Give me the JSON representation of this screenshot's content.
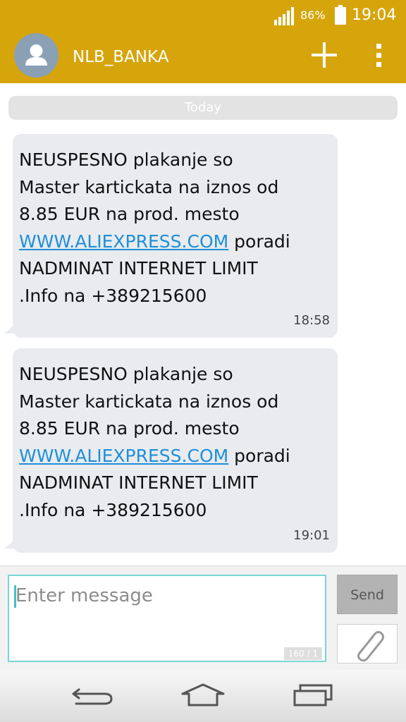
{
  "status_bar": {
    "battery_percent": "86%",
    "time": "19:04"
  },
  "app_bar": {
    "contact_name": "NLB_BANKA"
  },
  "conversation": {
    "date_separator": "Today",
    "messages": [
      {
        "text_before": "NEUSPESNO plakanje so\nMaster kartickata na iznos od\n8.85 EUR na prod. mesto\n",
        "link": "WWW.ALIEXPRESS.COM",
        "text_after": " poradi\nNADMINAT INTERNET LIMIT\n.Info na +389215600",
        "time": "18:58"
      },
      {
        "text_before": "NEUSPESNO plakanje so\nMaster kartickata na iznos od\n8.85 EUR na prod. mesto\n",
        "link": "WWW.ALIEXPRESS.COM",
        "text_after": " poradi\nNADMINAT INTERNET LIMIT\n.Info na +389215600",
        "time": "19:01"
      }
    ]
  },
  "composer": {
    "input_placeholder": "Enter message",
    "input_value": "",
    "char_counter": "160 / 1",
    "send_label": "Send"
  },
  "icons": {
    "signal": "signal-strength-icon",
    "battery": "battery-icon",
    "avatar": "person-icon",
    "add": "plus-icon",
    "more": "more-vertical-icon",
    "attach": "paperclip-icon",
    "back": "back-icon",
    "home": "home-icon",
    "recents": "recent-apps-icon"
  },
  "colors": {
    "accent": "#d6a50c",
    "link": "#1e8fd8",
    "bubble": "#e9ebef",
    "input_border": "#79d6d6"
  }
}
